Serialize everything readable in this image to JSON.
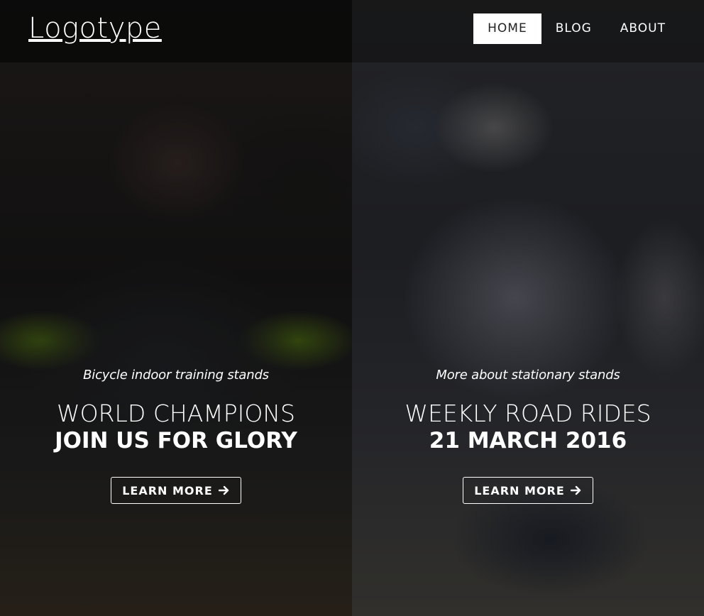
{
  "header": {
    "logo": "Logotype",
    "nav": [
      {
        "label": "HOME",
        "active": true
      },
      {
        "label": "BLOG",
        "active": false
      },
      {
        "label": "ABOUT",
        "active": false
      }
    ]
  },
  "panels": [
    {
      "kicker": "Bicycle indoor training stands",
      "title": "WORLD CHAMPIONS",
      "subtitle": "JOIN US FOR GLORY",
      "cta_label": "LEARN MORE",
      "cta_icon": "arrow-right-icon"
    },
    {
      "kicker": "More about stationary stands",
      "title": "WEEKLY ROAD RIDES",
      "subtitle": "21 MARCH 2016",
      "cta_label": "LEARN MORE",
      "cta_icon": "arrow-right-icon"
    }
  ],
  "colors": {
    "nav_active_bg": "#ffffff",
    "nav_active_text": "#222222",
    "text": "#ffffff"
  }
}
